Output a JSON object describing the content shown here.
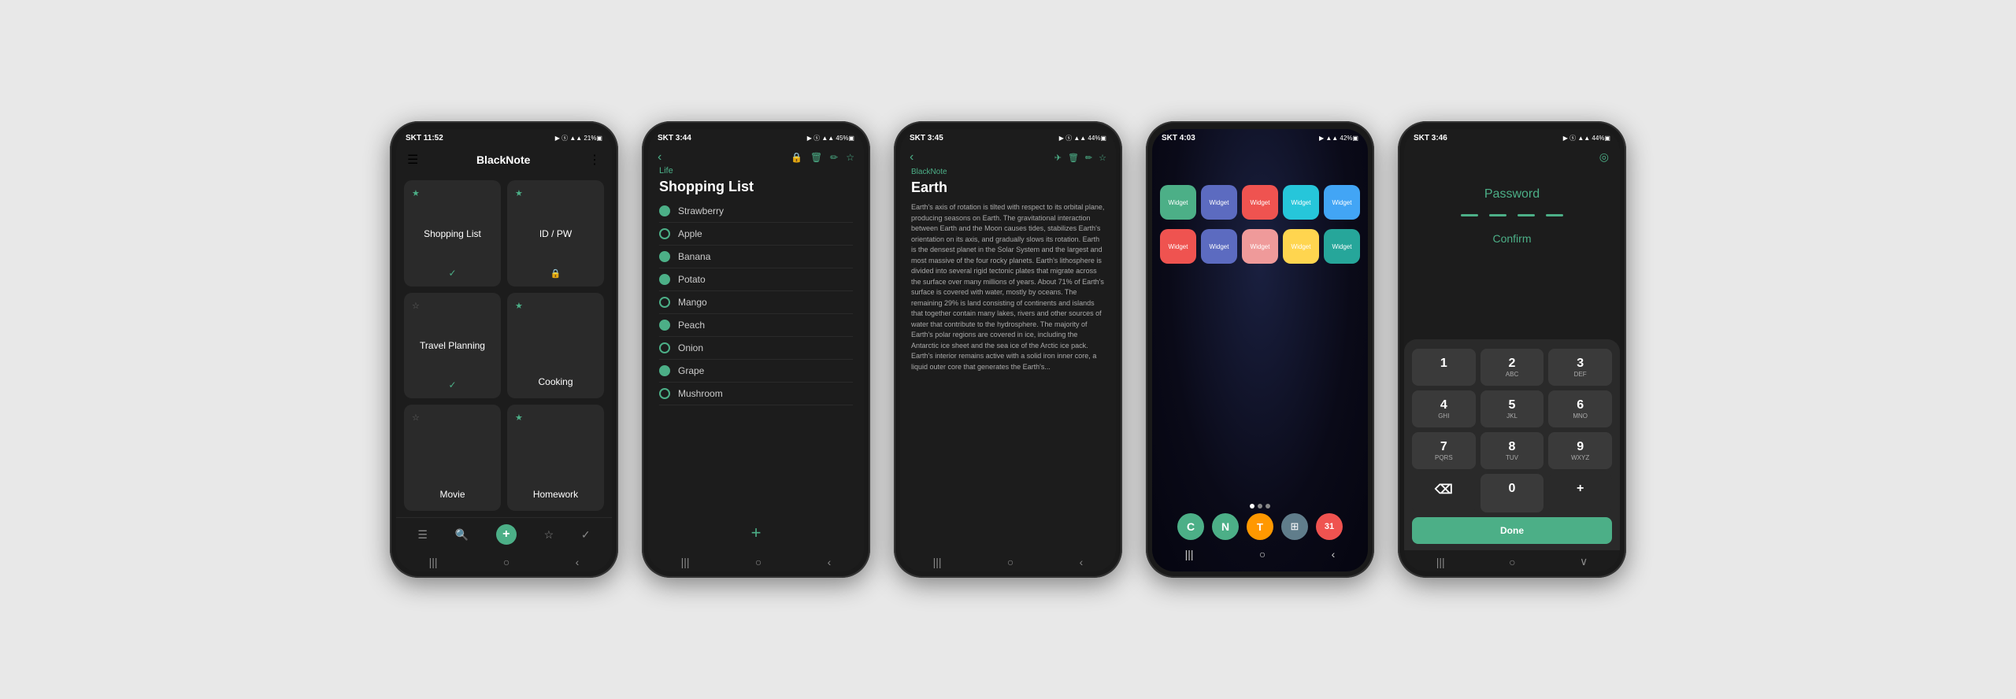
{
  "phones": [
    {
      "id": "phone1",
      "status": {
        "time": "SKT 11:52",
        "icons": "▶ ⓢ ▲▲▲ᵢ 21% ▣"
      },
      "header": {
        "menu": "☰",
        "title": "BlackNote",
        "more": "⋮"
      },
      "cards": [
        {
          "star": "★",
          "starColor": "green",
          "title": "Shopping List",
          "badge": "✓",
          "badgeType": "check"
        },
        {
          "star": "★",
          "starColor": "green",
          "title": "ID / PW",
          "badge": "🔒",
          "badgeType": "lock"
        },
        {
          "star": "☆",
          "starColor": "outline",
          "title": "Travel Planning",
          "badge": "✓",
          "badgeType": "check"
        },
        {
          "star": "★",
          "starColor": "green",
          "title": "Cooking",
          "badge": "",
          "badgeType": "none"
        },
        {
          "star": "☆",
          "starColor": "outline",
          "title": "Movie",
          "badge": "",
          "badgeType": "none"
        },
        {
          "star": "★",
          "starColor": "green",
          "title": "Homework",
          "badge": "",
          "badgeType": "none"
        }
      ],
      "bottom": {
        "icons": [
          "☰",
          "🔍",
          "+",
          "☆",
          "✓"
        ]
      }
    },
    {
      "id": "phone2",
      "status": {
        "time": "SKT 3:44",
        "icons": "▶ ⓢ ▲▲▲ᵢ 45% ▣"
      },
      "back": "‹",
      "topIcons": [
        "🔒",
        "🗑",
        "✏",
        "☆"
      ],
      "category": "Life",
      "title": "Shopping List",
      "items": [
        {
          "text": "Strawberry",
          "checked": true
        },
        {
          "text": "Apple",
          "checked": false
        },
        {
          "text": "Banana",
          "checked": true
        },
        {
          "text": "Potato",
          "checked": true
        },
        {
          "text": "Mango",
          "checked": false
        },
        {
          "text": "Peach",
          "checked": true
        },
        {
          "text": "Onion",
          "checked": false
        },
        {
          "text": "Grape",
          "checked": true
        },
        {
          "text": "Mushroom",
          "checked": false
        }
      ]
    },
    {
      "id": "phone3",
      "status": {
        "time": "SKT 3:45",
        "icons": "▶ ⓢ ▲▲▲ᵢ 44% ▣"
      },
      "back": "‹",
      "topIcons": [
        "✈",
        "🗑",
        "✏",
        "☆"
      ],
      "appName": "BlackNote",
      "title": "Earth",
      "content": "Earth's axis of rotation is tilted with respect to its orbital plane, producing seasons on Earth. The gravitational interaction between Earth and the Moon causes tides, stabilizes Earth's orientation on its axis, and gradually slows its rotation. Earth is the densest planet in the Solar System and the largest and most massive of the four rocky planets.\nEarth's lithosphere is divided into several rigid tectonic plates that migrate across the surface over many millions of years. About 71% of Earth's surface is covered with water, mostly by oceans. The remaining 29% is land consisting of continents and islands that together contain many lakes, rivers and other sources of water that contribute to the hydrosphere. The majority of Earth's polar regions are covered in ice, including the Antarctic ice sheet and the sea ice of the Arctic ice pack. Earth's interior remains active with a solid iron inner core, a liquid outer core that generates the Earth's..."
    },
    {
      "id": "phone4",
      "status": {
        "time": "SKT 4:03",
        "icons": "▶ ▲▲▲ᵢ 42% ▣"
      },
      "widgets1": [
        {
          "color": "#4caf87",
          "label": "Widget"
        },
        {
          "color": "#5c6bc0",
          "label": "Widget"
        },
        {
          "color": "#ef5350",
          "label": "Widget"
        },
        {
          "color": "#26c6da",
          "label": "Widget"
        },
        {
          "color": "#42a5f5",
          "label": "Widget"
        }
      ],
      "widgets2": [
        {
          "color": "#ef5350",
          "label": "Widget"
        },
        {
          "color": "#5c6bc0",
          "label": "Widget"
        },
        {
          "color": "#ef9a9a",
          "label": "Widget"
        },
        {
          "color": "#ffd54f",
          "label": "Widget"
        },
        {
          "color": "#26a69a",
          "label": "Widget"
        }
      ],
      "apps": [
        {
          "color": "#4caf87",
          "label": "C"
        },
        {
          "color": "#4caf87",
          "label": "N"
        },
        {
          "color": "#ff9800",
          "label": "T"
        },
        {
          "color": "#607d8b",
          "label": "⊞"
        },
        {
          "color": "#ef5350",
          "label": "31"
        }
      ]
    },
    {
      "id": "phone5",
      "status": {
        "time": "SKT 3:46",
        "icons": "▶ ⓢ ▲▲▲ᵢ 44% ▣"
      },
      "fpIcon": "◎",
      "passwordLabel": "Password",
      "dots": [
        "",
        "",
        "",
        ""
      ],
      "confirmLabel": "Confirm",
      "keys": [
        [
          {
            "num": "1",
            "sub": ""
          },
          {
            "num": "2",
            "sub": "ABC"
          },
          {
            "num": "3",
            "sub": "DEF"
          }
        ],
        [
          {
            "num": "4",
            "sub": "GHI"
          },
          {
            "num": "5",
            "sub": "JKL"
          },
          {
            "num": "6",
            "sub": "MNO"
          }
        ],
        [
          {
            "num": "7",
            "sub": "PQRS"
          },
          {
            "num": "8",
            "sub": "TUV"
          },
          {
            "num": "9",
            "sub": "WXYZ"
          }
        ],
        [
          {
            "num": "⌫",
            "sub": "",
            "type": "dark"
          },
          {
            "num": "0",
            "sub": ""
          },
          {
            "num": "+",
            "sub": ""
          },
          {
            "num": "Done",
            "sub": "",
            "type": "done"
          }
        ]
      ]
    }
  ]
}
